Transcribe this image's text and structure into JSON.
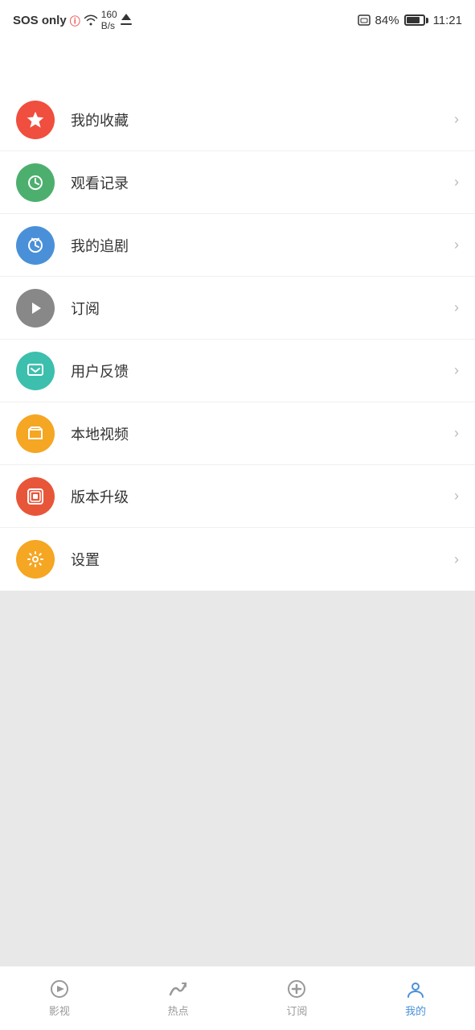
{
  "statusBar": {
    "left": "SOS only",
    "network": "160 B/s",
    "battery": "84%",
    "time": "11:21"
  },
  "menuItems": [
    {
      "id": "favorites",
      "icon": "⭐",
      "iconColor": "icon-red",
      "label": "我的收藏"
    },
    {
      "id": "history",
      "icon": "🕐",
      "iconColor": "icon-green",
      "label": "观看记录"
    },
    {
      "id": "followdrama",
      "icon": "⏰",
      "iconColor": "icon-blue",
      "label": "我的追剧"
    },
    {
      "id": "subscribe",
      "icon": "▶",
      "iconColor": "icon-gray",
      "label": "订阅"
    },
    {
      "id": "feedback",
      "icon": "💬",
      "iconColor": "icon-teal",
      "label": "用户反馈"
    },
    {
      "id": "localvideo",
      "icon": "📁",
      "iconColor": "icon-orange",
      "label": "本地视频"
    },
    {
      "id": "upgrade",
      "icon": "◈",
      "iconColor": "icon-multi",
      "label": "版本升级"
    },
    {
      "id": "settings",
      "icon": "⚙",
      "iconColor": "icon-amber",
      "label": "设置"
    }
  ],
  "bottomNav": [
    {
      "id": "video",
      "label": "影视",
      "active": false
    },
    {
      "id": "trending",
      "label": "热点",
      "active": false
    },
    {
      "id": "subscribe",
      "label": "订阅",
      "active": false
    },
    {
      "id": "mine",
      "label": "我的",
      "active": true
    }
  ]
}
